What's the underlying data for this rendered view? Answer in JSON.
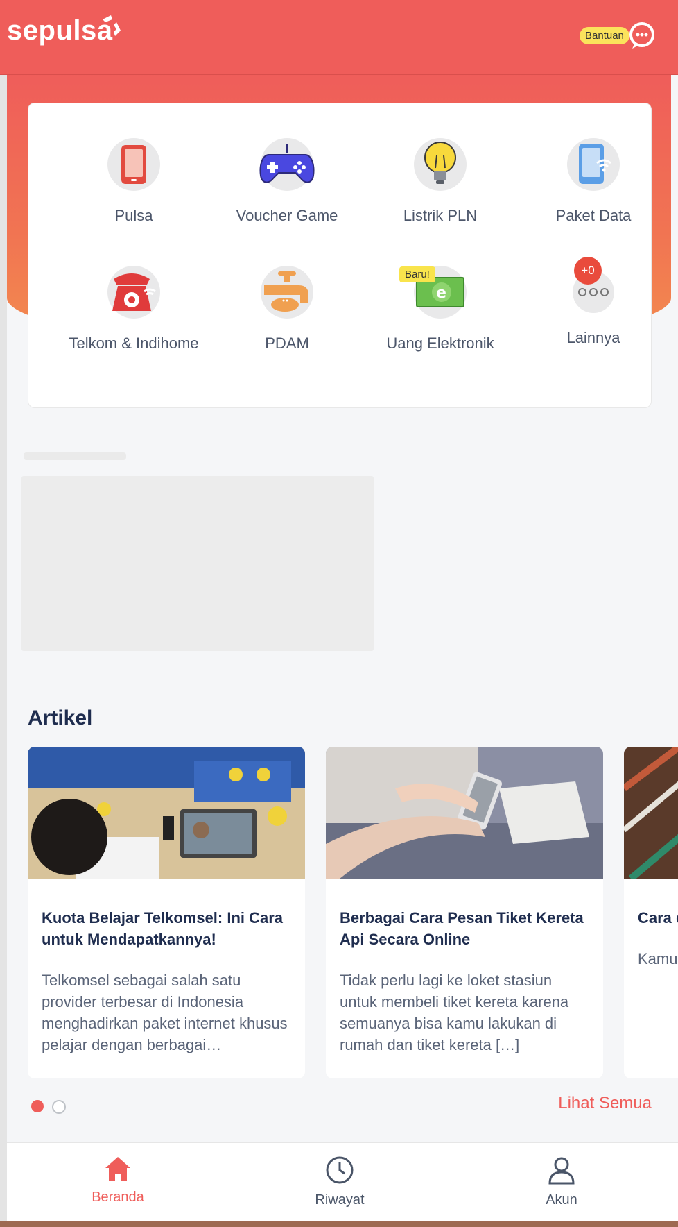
{
  "header": {
    "logo_text": "sepulsa",
    "help_label": "Bantuan"
  },
  "menu": {
    "items": [
      {
        "label": "Pulsa",
        "icon": "phone-icon"
      },
      {
        "label": "Voucher Game",
        "icon": "gamepad-icon"
      },
      {
        "label": "Listrik PLN",
        "icon": "lightbulb-icon"
      },
      {
        "label": "Paket Data",
        "icon": "phone-wifi-icon"
      },
      {
        "label": "Telkom & Indihome",
        "icon": "telephone-icon"
      },
      {
        "label": "PDAM",
        "icon": "water-tap-icon"
      },
      {
        "label": "Uang Elektronik",
        "icon": "e-money-icon"
      },
      {
        "label": "Lainnya",
        "icon": "more-icon"
      }
    ],
    "new_badge": "Baru!",
    "more_badge": "+0"
  },
  "articles": {
    "section_title": "Artikel",
    "items": [
      {
        "title": "Kuota Belajar Telkomsel: Ini Cara untuk Mendapatkannya!",
        "desc": "Telkomsel sebagai salah satu provider terbesar di Indonesia menghadirkan paket internet khusus pelajar dengan berbagai…"
      },
      {
        "title": "Berbagai Cara Pesan Tiket Kereta Api Secara Online",
        "desc": "Tidak perlu lagi ke loket stasiun untuk membeli tiket kereta karena semuanya bisa kamu lakukan di rumah dan tiket kereta […]"
      },
      {
        "title": "Cara deng",
        "desc": "Kamu kota suda PT Ke"
      }
    ],
    "see_all": "Lihat Semua"
  },
  "nav": {
    "items": [
      {
        "label": "Beranda",
        "icon": "home-icon"
      },
      {
        "label": "Riwayat",
        "icon": "clock-icon"
      },
      {
        "label": "Akun",
        "icon": "user-icon"
      }
    ]
  },
  "colors": {
    "brand": "#ef5d5a",
    "title": "#1f2d4f",
    "active_nav": "#ef5d5a",
    "inactive_nav": "#4a5568"
  }
}
